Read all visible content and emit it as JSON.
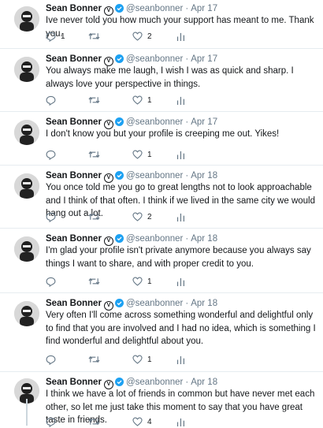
{
  "author": {
    "name": "Sean Bonner",
    "handle": "@seanbonner",
    "v_badge": "V"
  },
  "separator": "·",
  "colors": {
    "verified": "#1da1f2",
    "secondary_text": "#657786",
    "divider": "#e6ecf0"
  },
  "icons": {
    "reply": "reply-icon",
    "retweet": "retweet-icon",
    "like": "heart-icon",
    "analytics": "analytics-icon"
  },
  "tweets": [
    {
      "date": "Apr 17",
      "text": "Ive never told you how much your support has meant to me. Thank you.",
      "replies": "1",
      "retweets": "",
      "likes": "2"
    },
    {
      "date": "Apr 17",
      "text": "You always make me laugh, I wish I was as quick and sharp. I always love your perspective in things.",
      "replies": "",
      "retweets": "",
      "likes": "1"
    },
    {
      "date": "Apr 17",
      "text": "I don't know you but your profile is creeping me out. Yikes!",
      "replies": "",
      "retweets": "",
      "likes": "1"
    },
    {
      "date": "Apr 18",
      "text": "You once told me you go to great lengths not to look approachable and I think of that often. I think if we lived in the same city we would hang out a lot.",
      "replies": "",
      "retweets": "",
      "likes": "2"
    },
    {
      "date": "Apr 18",
      "text": "I'm glad your profile isn't private anymore because you always say things I want to share, and with proper credit to you.",
      "replies": "",
      "retweets": "",
      "likes": "1"
    },
    {
      "date": "Apr 18",
      "text": "Very often I'll come across something wonderful and delightful only to find that you are involved and I had no idea, which is something I find wonderful and delightful about you.",
      "replies": "",
      "retweets": "",
      "likes": "1"
    },
    {
      "date": "Apr 18",
      "text": "I think we have a lot of friends in common but have never met each other, so let me just take this moment to say that you have great taste in friends.",
      "replies": "",
      "retweets": "",
      "likes": "4"
    }
  ]
}
